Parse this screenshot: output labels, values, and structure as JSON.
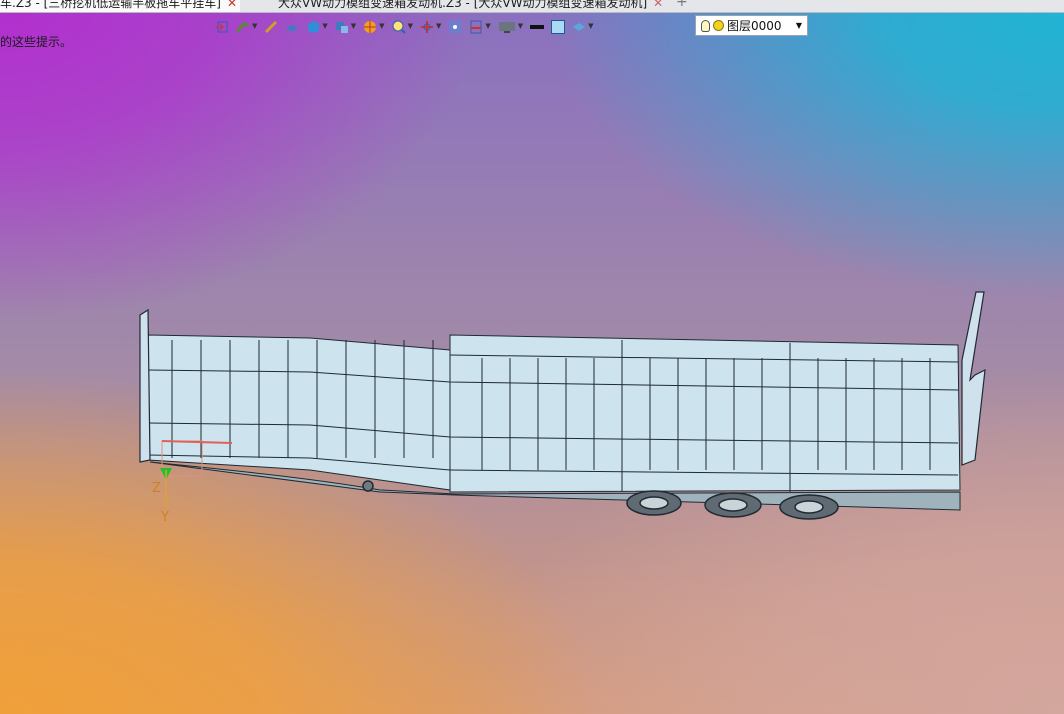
{
  "tabs": [
    {
      "label": "车.Z3 - [三桥挖机低运输半板拖车平挂车]",
      "active": true
    },
    {
      "label": "大众VW动力模组变速箱发动机.Z3 - [大众VW动力模组变速箱发动机]",
      "active": false
    }
  ],
  "tab_close_glyph": "✕",
  "tab_add_glyph": "+",
  "hint_text": "的这些提示。",
  "layer": {
    "name": "图层0000"
  },
  "axis": {
    "y_label": "Y",
    "z_label": "Z"
  },
  "toolbar_icons": [
    "exit-icon",
    "sweep-icon",
    "pen-icon",
    "plane-icon",
    "box-icon",
    "combine-icon",
    "render-icon",
    "zoom-icon",
    "axis-icon",
    "snap-icon",
    "section-icon",
    "display-icon",
    "line-color-icon",
    "fill-color-icon",
    "layer-icon"
  ],
  "colors": {
    "accent": "#1fb5d4",
    "model_fill": "#cfe6f0",
    "model_stroke": "#1f2a33"
  }
}
